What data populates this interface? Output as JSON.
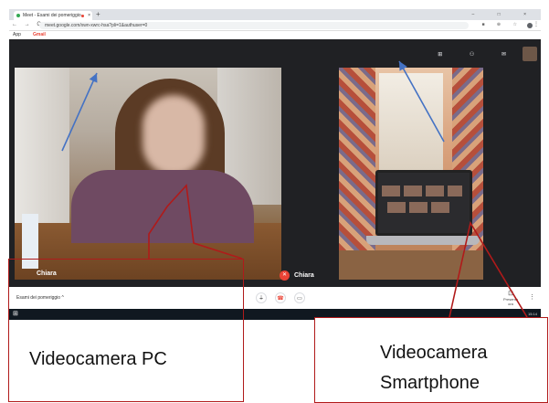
{
  "browser": {
    "tab_title": "Meet - Esami dei pomeriggio",
    "tab_close": "×",
    "new_tab": "+",
    "window_buttons": "–  □  ×",
    "nav_glyphs": "← → C",
    "url": "meet.google.com/xwn-xwrc-hsa?pli=1&authuser=0",
    "addr_icons": "■ ⊕ ☆",
    "kebab": "⋮",
    "bookmarks": [
      {
        "label": "App"
      },
      {
        "label": "Gmail"
      }
    ]
  },
  "meet": {
    "top_icons": "⊞ ⚇ ✉",
    "left_tile": {
      "name": "Chiara"
    },
    "right_tile": {
      "name": "Chiara",
      "mute_glyph": "✕"
    },
    "meeting_name": "Esami dei pomeriggio",
    "meeting_name_chevron": "^",
    "controls": {
      "mic_glyph": "⏚",
      "hangup_glyph": "☎",
      "camera_glyph": "▭"
    },
    "present": {
      "icon": "⊡",
      "label": "Presenta ora"
    },
    "menu_dots": "⋮"
  },
  "taskbar": {
    "windows_glyph": "⊞",
    "time": "15:14"
  },
  "annotations": {
    "pc_label": "Videocamera PC",
    "smartphone_label_line1": "Videocamera",
    "smartphone_label_line2": "Smartphone"
  },
  "colors": {
    "arrow": "#4472c4",
    "callout": "#b01a1a",
    "meet_bg": "#202124"
  }
}
